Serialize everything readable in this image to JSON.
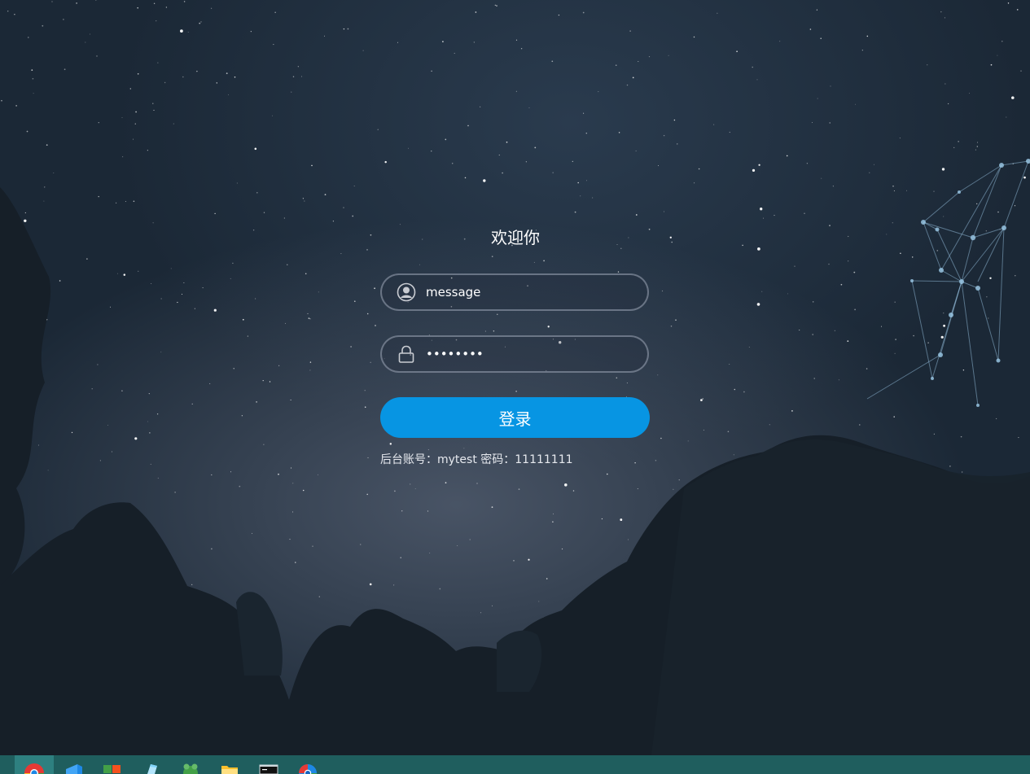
{
  "login": {
    "title": "欢迎你",
    "username_value": "message",
    "password_value": "11111111",
    "submit_label": "登录",
    "hint": "后台账号：mytest 密码：11111111"
  },
  "taskbar": {
    "items": [
      {
        "icon": "chrome-icon",
        "active": true
      },
      {
        "icon": "vscode-icon"
      },
      {
        "icon": "windows-store-icon"
      },
      {
        "icon": "notepad-icon"
      },
      {
        "icon": "frog-app-icon"
      },
      {
        "icon": "file-explorer-icon"
      },
      {
        "icon": "terminal-icon"
      },
      {
        "icon": "chromium-icon"
      }
    ]
  },
  "colors": {
    "button": "#0795e3",
    "taskbar": "#1f5e5e"
  }
}
